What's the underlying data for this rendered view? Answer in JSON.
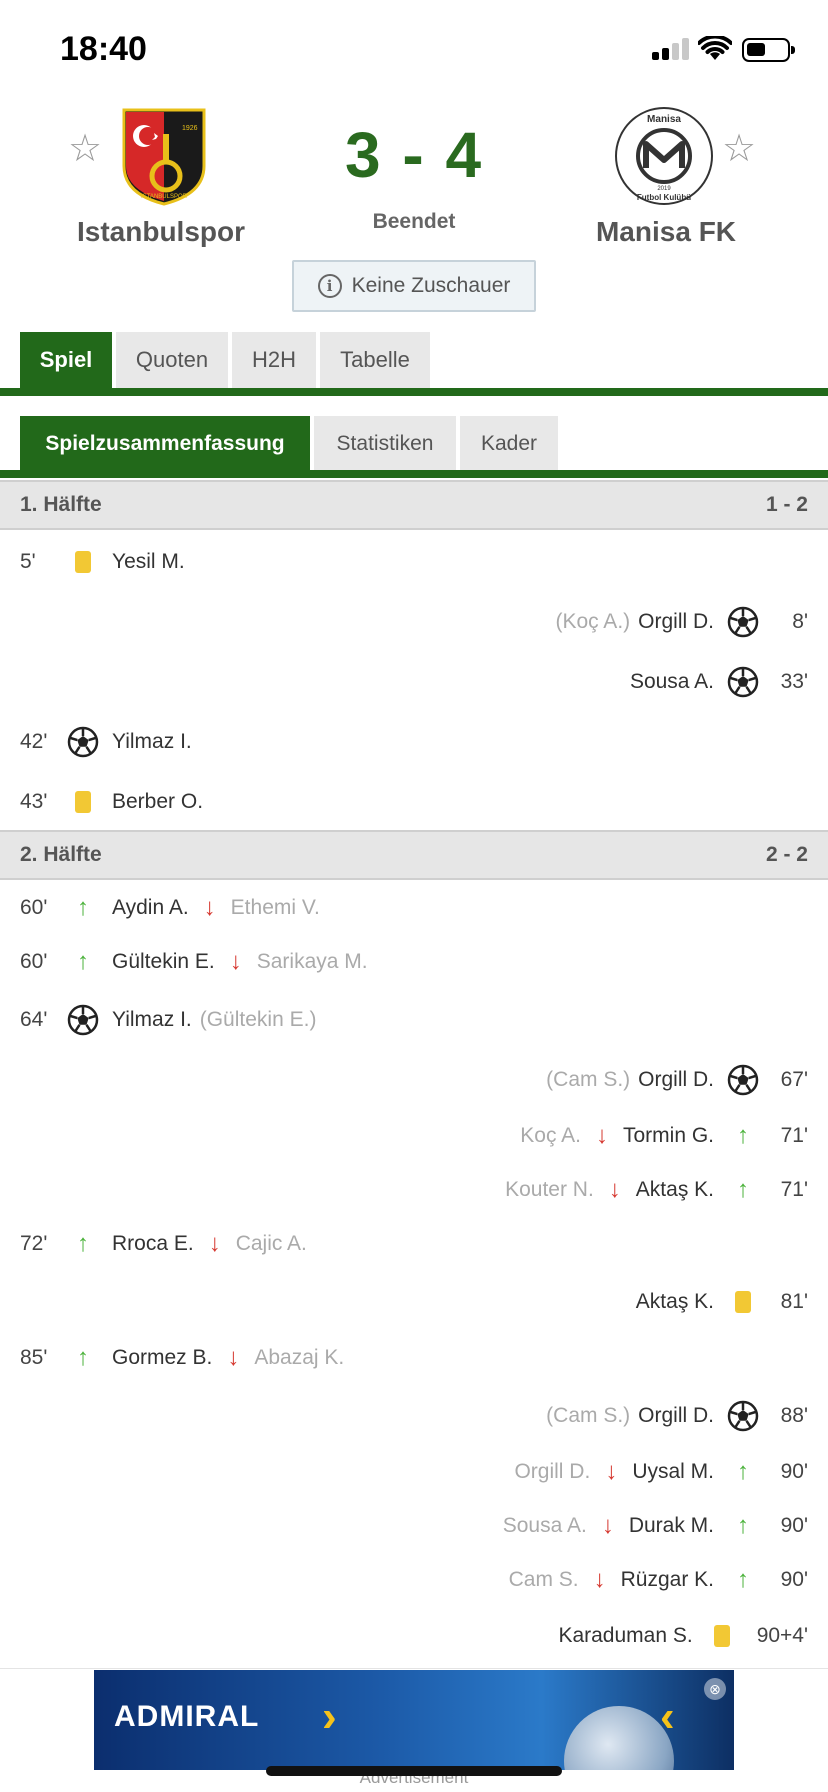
{
  "status_bar": {
    "time": "18:40"
  },
  "match": {
    "home_team": "Istanbulspor",
    "away_team": "Manisa FK",
    "score": "3 - 4",
    "status": "Beendet",
    "info": "Keine Zuschauer",
    "home_crest_text": [
      "1926",
      "ISTANBULSPOR"
    ],
    "away_crest_text": [
      "Manisa",
      "2019",
      "Futbol Kulübü"
    ]
  },
  "tabs_main": [
    {
      "label": "Spiel",
      "active": true
    },
    {
      "label": "Quoten",
      "active": false
    },
    {
      "label": "H2H",
      "active": false
    },
    {
      "label": "Tabelle",
      "active": false
    }
  ],
  "tabs_sub": [
    {
      "label": "Spielzusammenfassung",
      "active": true
    },
    {
      "label": "Statistiken",
      "active": false
    },
    {
      "label": "Kader",
      "active": false
    }
  ],
  "halves": [
    {
      "title": "1. Hälfte",
      "score": "1 - 2"
    },
    {
      "title": "2. Hälfte",
      "score": "2 - 2"
    }
  ],
  "events": [
    {
      "side": "home",
      "minute": "5'",
      "type": "yellow",
      "player": "Yesil M.",
      "extra": ""
    },
    {
      "side": "away",
      "minute": "8'",
      "type": "goal",
      "player": "Orgill D.",
      "extra": "(Koç A.)"
    },
    {
      "side": "away",
      "minute": "33'",
      "type": "goal",
      "player": "Sousa A.",
      "extra": ""
    },
    {
      "side": "home",
      "minute": "42'",
      "type": "goal",
      "player": "Yilmaz I.",
      "extra": ""
    },
    {
      "side": "home",
      "minute": "43'",
      "type": "yellow",
      "player": "Berber O.",
      "extra": ""
    },
    {
      "side": "home",
      "minute": "60'",
      "type": "sub",
      "player": "Aydin A.",
      "extra": "Ethemi V."
    },
    {
      "side": "home",
      "minute": "60'",
      "type": "sub",
      "player": "Gültekin E.",
      "extra": "Sarikaya M."
    },
    {
      "side": "home",
      "minute": "64'",
      "type": "goal",
      "player": "Yilmaz I.",
      "extra": "(Gültekin E.)"
    },
    {
      "side": "away",
      "minute": "67'",
      "type": "goal",
      "player": "Orgill D.",
      "extra": "(Cam S.)"
    },
    {
      "side": "away",
      "minute": "71'",
      "type": "sub",
      "player": "Tormin G.",
      "extra": "Koç A."
    },
    {
      "side": "away",
      "minute": "71'",
      "type": "sub",
      "player": "Aktaş K.",
      "extra": "Kouter N."
    },
    {
      "side": "home",
      "minute": "72'",
      "type": "sub",
      "player": "Rroca E.",
      "extra": "Cajic A."
    },
    {
      "side": "away",
      "minute": "81'",
      "type": "yellow",
      "player": "Aktaş K.",
      "extra": ""
    },
    {
      "side": "home",
      "minute": "85'",
      "type": "sub",
      "player": "Gormez B.",
      "extra": "Abazaj K."
    },
    {
      "side": "away",
      "minute": "88'",
      "type": "goal",
      "player": "Orgill D.",
      "extra": "(Cam S.)"
    },
    {
      "side": "away",
      "minute": "90'",
      "type": "sub",
      "player": "Uysal M.",
      "extra": "Orgill D."
    },
    {
      "side": "away",
      "minute": "90'",
      "type": "sub",
      "player": "Durak M.",
      "extra": "Sousa A."
    },
    {
      "side": "away",
      "minute": "90'",
      "type": "sub",
      "player": "Rüzgar K.",
      "extra": "Cam S."
    },
    {
      "side": "away",
      "minute": "90+4'",
      "type": "yellow",
      "player": "Karaduman S.",
      "extra": ""
    }
  ],
  "ad": {
    "brand": "ADMIRAL",
    "label": "Advertisement"
  },
  "colors": {
    "accent_green": "#22691a",
    "score_green": "#2a6a1f",
    "yellow_card": "#f2c834",
    "sub_in": "#4db33d",
    "sub_out": "#d63a32"
  },
  "icons": {
    "goal": "soccer-ball-icon",
    "yellow": "yellow-card-icon",
    "sub_in": "arrow-up-icon",
    "sub_out": "arrow-down-icon",
    "favorite": "star-icon",
    "info": "info-icon"
  }
}
